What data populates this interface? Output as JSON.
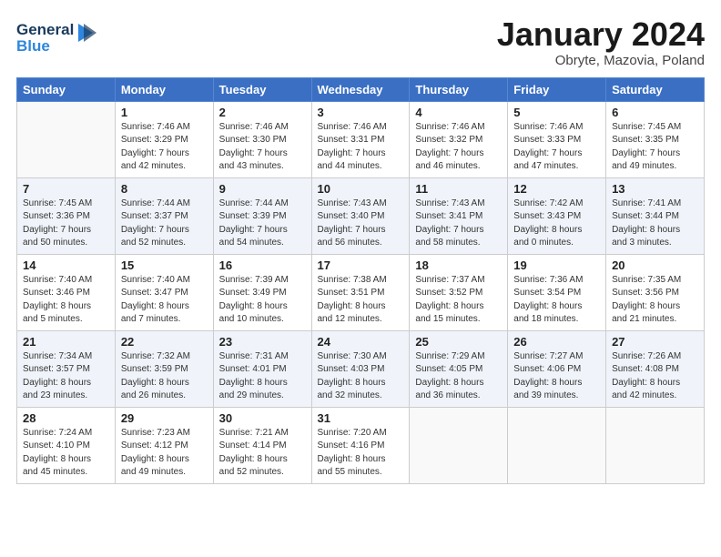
{
  "logo": {
    "line1": "General",
    "line2": "Blue"
  },
  "header": {
    "month": "January 2024",
    "location": "Obryte, Mazovia, Poland"
  },
  "weekdays": [
    "Sunday",
    "Monday",
    "Tuesday",
    "Wednesday",
    "Thursday",
    "Friday",
    "Saturday"
  ],
  "weeks": [
    [
      {
        "day": "",
        "detail": ""
      },
      {
        "day": "1",
        "detail": "Sunrise: 7:46 AM\nSunset: 3:29 PM\nDaylight: 7 hours\nand 42 minutes."
      },
      {
        "day": "2",
        "detail": "Sunrise: 7:46 AM\nSunset: 3:30 PM\nDaylight: 7 hours\nand 43 minutes."
      },
      {
        "day": "3",
        "detail": "Sunrise: 7:46 AM\nSunset: 3:31 PM\nDaylight: 7 hours\nand 44 minutes."
      },
      {
        "day": "4",
        "detail": "Sunrise: 7:46 AM\nSunset: 3:32 PM\nDaylight: 7 hours\nand 46 minutes."
      },
      {
        "day": "5",
        "detail": "Sunrise: 7:46 AM\nSunset: 3:33 PM\nDaylight: 7 hours\nand 47 minutes."
      },
      {
        "day": "6",
        "detail": "Sunrise: 7:45 AM\nSunset: 3:35 PM\nDaylight: 7 hours\nand 49 minutes."
      }
    ],
    [
      {
        "day": "7",
        "detail": "Sunrise: 7:45 AM\nSunset: 3:36 PM\nDaylight: 7 hours\nand 50 minutes."
      },
      {
        "day": "8",
        "detail": "Sunrise: 7:44 AM\nSunset: 3:37 PM\nDaylight: 7 hours\nand 52 minutes."
      },
      {
        "day": "9",
        "detail": "Sunrise: 7:44 AM\nSunset: 3:39 PM\nDaylight: 7 hours\nand 54 minutes."
      },
      {
        "day": "10",
        "detail": "Sunrise: 7:43 AM\nSunset: 3:40 PM\nDaylight: 7 hours\nand 56 minutes."
      },
      {
        "day": "11",
        "detail": "Sunrise: 7:43 AM\nSunset: 3:41 PM\nDaylight: 7 hours\nand 58 minutes."
      },
      {
        "day": "12",
        "detail": "Sunrise: 7:42 AM\nSunset: 3:43 PM\nDaylight: 8 hours\nand 0 minutes."
      },
      {
        "day": "13",
        "detail": "Sunrise: 7:41 AM\nSunset: 3:44 PM\nDaylight: 8 hours\nand 3 minutes."
      }
    ],
    [
      {
        "day": "14",
        "detail": "Sunrise: 7:40 AM\nSunset: 3:46 PM\nDaylight: 8 hours\nand 5 minutes."
      },
      {
        "day": "15",
        "detail": "Sunrise: 7:40 AM\nSunset: 3:47 PM\nDaylight: 8 hours\nand 7 minutes."
      },
      {
        "day": "16",
        "detail": "Sunrise: 7:39 AM\nSunset: 3:49 PM\nDaylight: 8 hours\nand 10 minutes."
      },
      {
        "day": "17",
        "detail": "Sunrise: 7:38 AM\nSunset: 3:51 PM\nDaylight: 8 hours\nand 12 minutes."
      },
      {
        "day": "18",
        "detail": "Sunrise: 7:37 AM\nSunset: 3:52 PM\nDaylight: 8 hours\nand 15 minutes."
      },
      {
        "day": "19",
        "detail": "Sunrise: 7:36 AM\nSunset: 3:54 PM\nDaylight: 8 hours\nand 18 minutes."
      },
      {
        "day": "20",
        "detail": "Sunrise: 7:35 AM\nSunset: 3:56 PM\nDaylight: 8 hours\nand 21 minutes."
      }
    ],
    [
      {
        "day": "21",
        "detail": "Sunrise: 7:34 AM\nSunset: 3:57 PM\nDaylight: 8 hours\nand 23 minutes."
      },
      {
        "day": "22",
        "detail": "Sunrise: 7:32 AM\nSunset: 3:59 PM\nDaylight: 8 hours\nand 26 minutes."
      },
      {
        "day": "23",
        "detail": "Sunrise: 7:31 AM\nSunset: 4:01 PM\nDaylight: 8 hours\nand 29 minutes."
      },
      {
        "day": "24",
        "detail": "Sunrise: 7:30 AM\nSunset: 4:03 PM\nDaylight: 8 hours\nand 32 minutes."
      },
      {
        "day": "25",
        "detail": "Sunrise: 7:29 AM\nSunset: 4:05 PM\nDaylight: 8 hours\nand 36 minutes."
      },
      {
        "day": "26",
        "detail": "Sunrise: 7:27 AM\nSunset: 4:06 PM\nDaylight: 8 hours\nand 39 minutes."
      },
      {
        "day": "27",
        "detail": "Sunrise: 7:26 AM\nSunset: 4:08 PM\nDaylight: 8 hours\nand 42 minutes."
      }
    ],
    [
      {
        "day": "28",
        "detail": "Sunrise: 7:24 AM\nSunset: 4:10 PM\nDaylight: 8 hours\nand 45 minutes."
      },
      {
        "day": "29",
        "detail": "Sunrise: 7:23 AM\nSunset: 4:12 PM\nDaylight: 8 hours\nand 49 minutes."
      },
      {
        "day": "30",
        "detail": "Sunrise: 7:21 AM\nSunset: 4:14 PM\nDaylight: 8 hours\nand 52 minutes."
      },
      {
        "day": "31",
        "detail": "Sunrise: 7:20 AM\nSunset: 4:16 PM\nDaylight: 8 hours\nand 55 minutes."
      },
      {
        "day": "",
        "detail": ""
      },
      {
        "day": "",
        "detail": ""
      },
      {
        "day": "",
        "detail": ""
      }
    ]
  ]
}
